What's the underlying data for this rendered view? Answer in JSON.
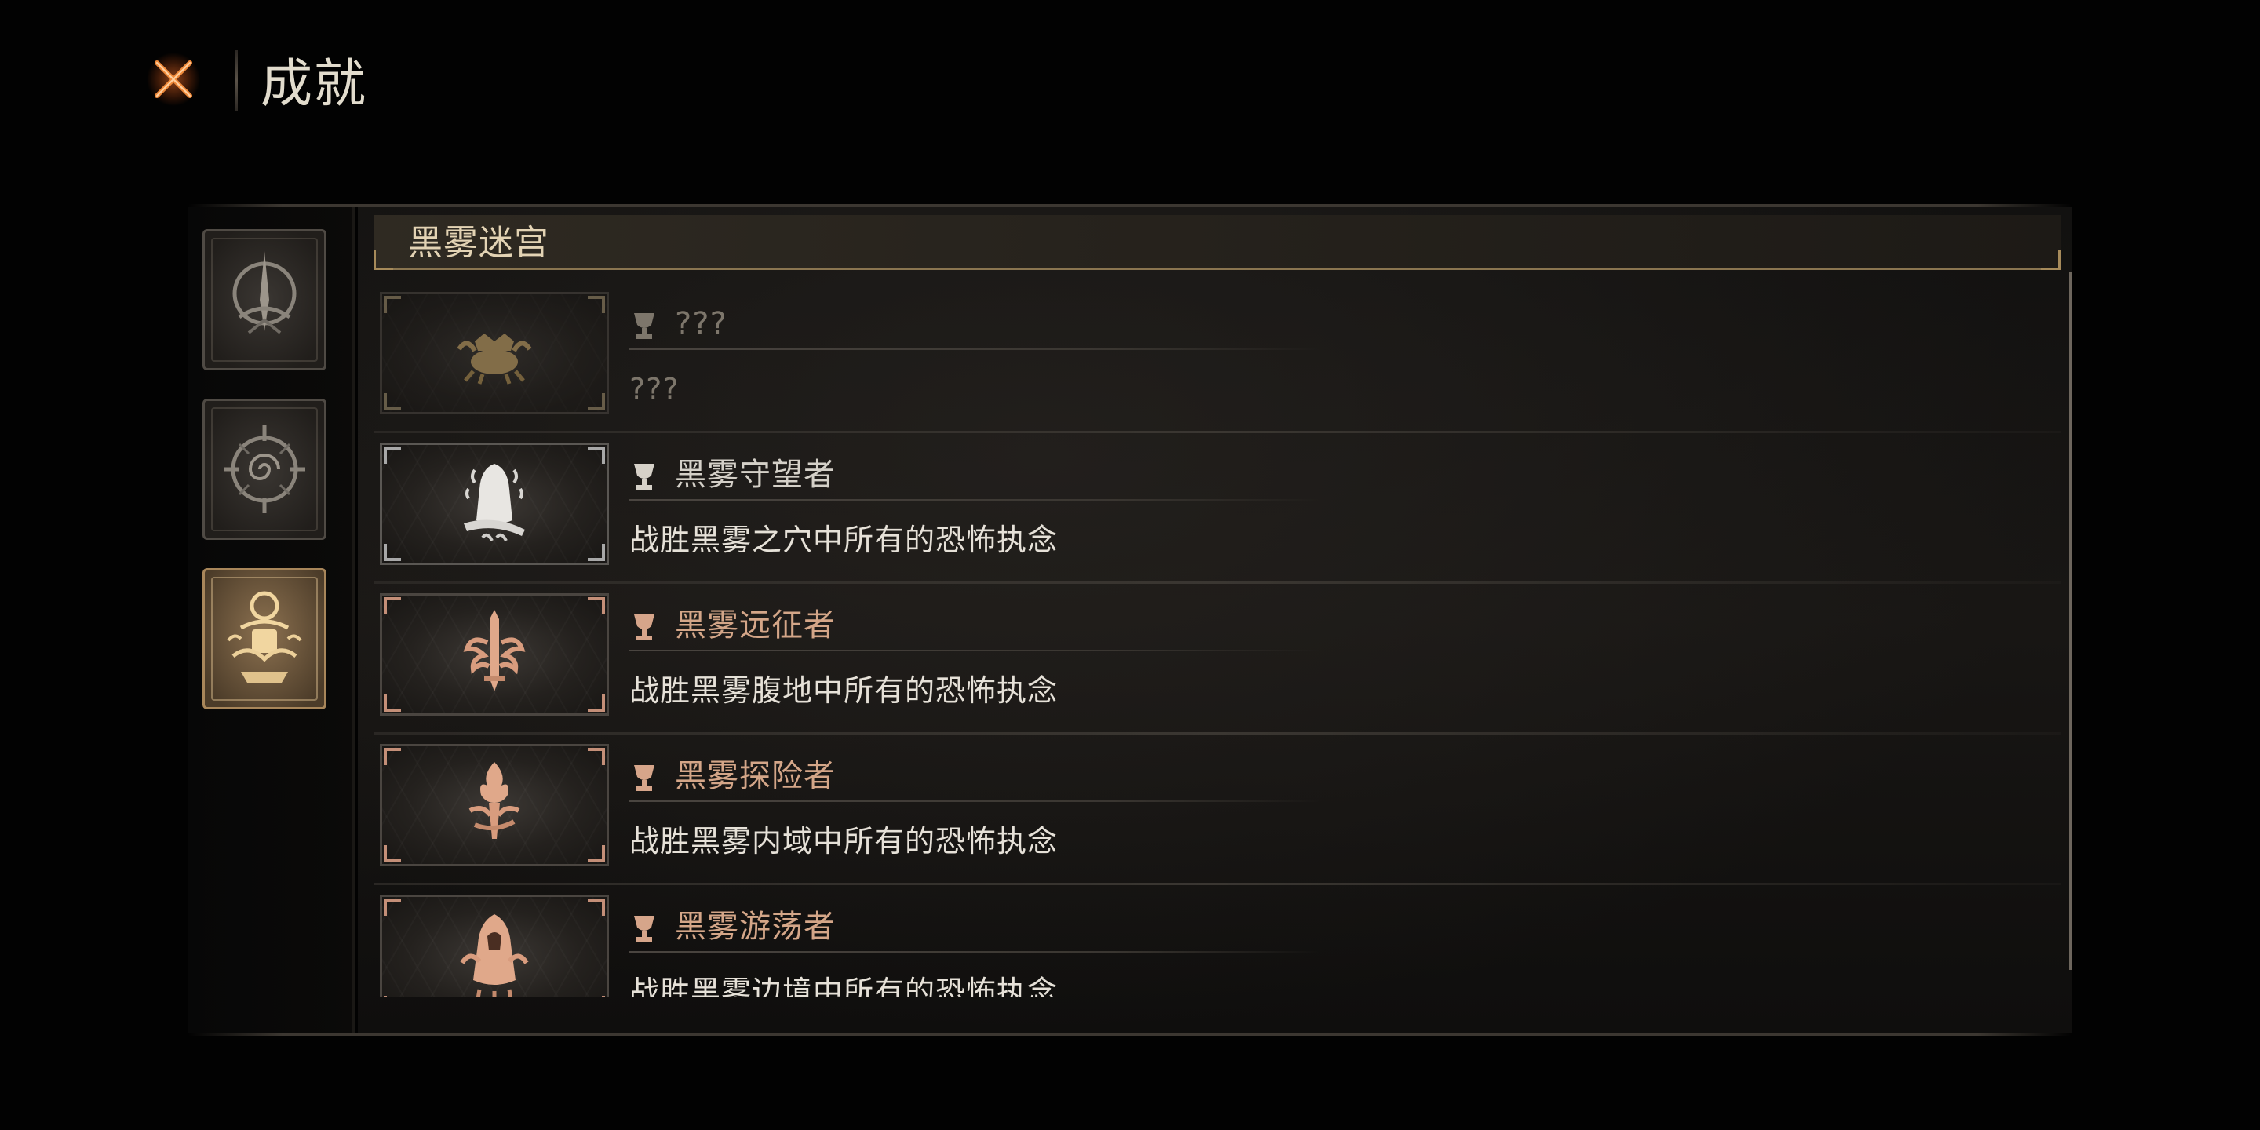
{
  "header": {
    "title": "成就",
    "close_icon": "close-x-icon"
  },
  "sidebar": {
    "categories": [
      {
        "icon": "spire-sigil-icon",
        "active": false
      },
      {
        "icon": "compass-spiral-icon",
        "active": false
      },
      {
        "icon": "black-fog-labyrinth-icon",
        "active": true
      }
    ]
  },
  "section": {
    "title": "黑雾迷宫"
  },
  "achievements": [
    {
      "name": "???",
      "description": "???",
      "locked": true,
      "icon": "crab-crest-icon",
      "accent": "#9a8a6a"
    },
    {
      "name": "黑雾守望者",
      "description": "战胜黑雾之穴中所有的恐怖执念",
      "locked": false,
      "icon": "hooded-figure-icon",
      "accent": "#a8a8a8"
    },
    {
      "name": "黑雾远征者",
      "description": "战胜黑雾腹地中所有的恐怖执念",
      "locked": false,
      "icon": "sword-wings-icon",
      "accent": "#c48f78"
    },
    {
      "name": "黑雾探险者",
      "description": "战胜黑雾内域中所有的恐怖执念",
      "locked": false,
      "icon": "torch-flame-icon",
      "accent": "#c48f78"
    },
    {
      "name": "黑雾游荡者",
      "description": "战胜黑雾边境中所有的恐怖执念",
      "locked": false,
      "icon": "cloaked-wanderer-icon",
      "accent": "#c48f78"
    }
  ],
  "colors": {
    "accent_gold": "#a8865a",
    "name_gold": "#c8a07e",
    "close_orange": "#e0622a"
  }
}
